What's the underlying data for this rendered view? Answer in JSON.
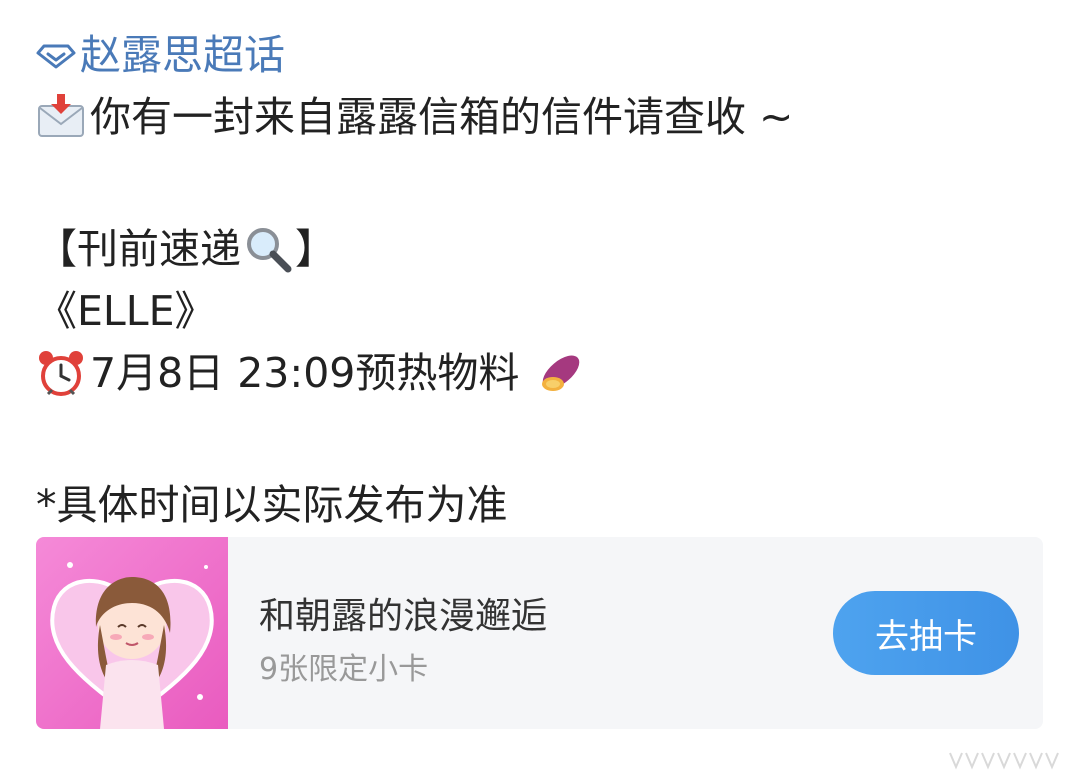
{
  "post": {
    "topic": "赵露思超话",
    "topic_icon": "diamond-topic-icon",
    "line1_icon": "envelope-inbox-icon",
    "line1_text": "你有一封来自露露信箱的信件请查收 ~",
    "section_open": "【刊前速递",
    "section_icon": "magnifier-icon",
    "section_close": "】",
    "magazine": "《ELLE》",
    "time_icon": "alarm-clock-icon",
    "time_text": "7月8日 23:09预热物料",
    "time_trail_icon": "sweet-potato-icon",
    "note": "*具体时间以实际发布为准"
  },
  "card": {
    "title": "和朝露的浪漫邂逅",
    "subtitle": "9张限定小卡",
    "button_label": "去抽卡"
  },
  "colors": {
    "topic_link": "#4a7ab8",
    "button_start": "#4ea3ef",
    "button_end": "#3f92e6",
    "card_bg": "#f5f6f8",
    "thumb_pink": "#f06fc9"
  }
}
